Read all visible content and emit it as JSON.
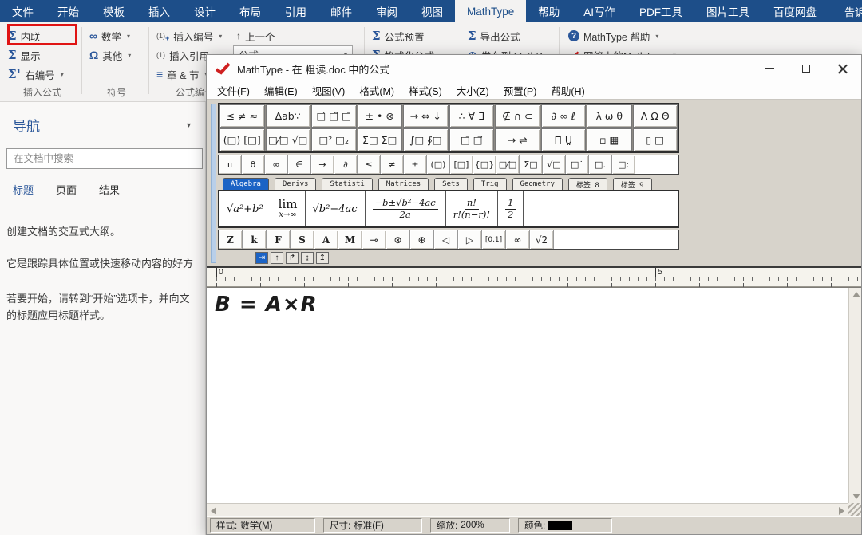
{
  "colors": {
    "ribbon_blue": "#1d4e89",
    "accent_blue": "#2b579a",
    "highlight_red": "#e01414",
    "tab_selected_blue": "#1b63c5",
    "status_swatch": "#000000"
  },
  "ribbon": {
    "tabs": [
      {
        "label": "文件"
      },
      {
        "label": "开始"
      },
      {
        "label": "模板"
      },
      {
        "label": "插入"
      },
      {
        "label": "设计"
      },
      {
        "label": "布局"
      },
      {
        "label": "引用"
      },
      {
        "label": "邮件"
      },
      {
        "label": "审阅"
      },
      {
        "label": "视图"
      },
      {
        "label": "MathType",
        "selected": true
      },
      {
        "label": "帮助"
      },
      {
        "label": "AI写作"
      },
      {
        "label": "PDF工具"
      },
      {
        "label": "图片工具"
      },
      {
        "label": "百度网盘"
      }
    ],
    "tell_me": "告诉我你",
    "buttons": {
      "inline": "内联",
      "display": "显示",
      "right_number": "右编号",
      "math": "数学",
      "other": "其他",
      "insert_number": "插入编号",
      "insert_reference": "插入引用",
      "chapter_section": "章 & 节",
      "previous": "上一个",
      "formula_box": "公式",
      "preset": "公式预置",
      "format": "格式化公式",
      "export": "导出公式",
      "publish": "发布到 MathPage",
      "help": "MathType 帮助",
      "web": "网络上的MathType"
    },
    "group_labels": {
      "insert": "插入公式",
      "symbols": "符号",
      "numbering": "公式编号"
    }
  },
  "icons": {
    "sigma": "Σ",
    "sigma_sup": "1",
    "infinity": "∞",
    "omega": "Ω",
    "up_arrow": "↑",
    "list": "≡",
    "number_badge": "(1)",
    "plus": "+",
    "globe": "⊕",
    "question": "?",
    "caret": "▾"
  },
  "sidebar": {
    "title": "导航",
    "search_placeholder": "在文档中搜索",
    "tabs": [
      {
        "label": "标题",
        "selected": true
      },
      {
        "label": "页面"
      },
      {
        "label": "结果"
      }
    ],
    "paragraphs": [
      "创建文档的交互式大纲。",
      "它是跟踪具体位置或快速移动内容的好方",
      "若要开始，请转到“开始”选项卡，并向文",
      "的标题应用标题样式。"
    ]
  },
  "mathtype": {
    "window_title": "MathType - 在 粗读.doc 中的公式",
    "menus": [
      "文件(F)",
      "编辑(E)",
      "视图(V)",
      "格式(M)",
      "样式(S)",
      "大小(Z)",
      "预置(P)",
      "帮助(H)"
    ],
    "palette_row1": [
      "≤ ≠ ≈",
      "∆ab∵",
      "□́ □̈ □̄",
      "± • ⊗",
      "→ ⇔ ↓",
      "∴ ∀ ∃",
      "∉ ∩ ⊂",
      "∂ ∞ ℓ",
      "λ ω θ",
      "Λ Ω Θ"
    ],
    "palette_row2": [
      "(□) [□]",
      "□⁄□ √□",
      "□² □₂",
      "Σ□ Σ□",
      "∫□ ∮□",
      "□̄ □⃗",
      "→ ⇌",
      "Π̈ Ṳ",
      "▫ ▦",
      "▯ □"
    ],
    "small_row": [
      "π",
      "θ",
      "∞",
      "∈",
      "→",
      "∂",
      "≤",
      "≠",
      "±",
      "(□)",
      "[□]",
      "{□}",
      "□⁄□",
      "Σ□",
      "√□",
      "□˙",
      "□.",
      "□:"
    ],
    "tabs": [
      {
        "label": "Algebra",
        "selected": true
      },
      {
        "label": "Derivs"
      },
      {
        "label": "Statisti"
      },
      {
        "label": "Matrices"
      },
      {
        "label": "Sets"
      },
      {
        "label": "Trig"
      },
      {
        "label": "Geometry"
      },
      {
        "label": "标签 8"
      },
      {
        "label": "标签 9"
      }
    ],
    "templates": [
      {
        "text": "√a²+b²"
      },
      {
        "top": "lim",
        "bottom": "x→∞"
      },
      {
        "text": "√b²−4ac"
      },
      {
        "top": "−b±√b²−4ac",
        "bottom": "2a"
      },
      {
        "top": "n!",
        "bottom": "r!(n−r)!"
      },
      {
        "top": "1",
        "bottom": "2"
      }
    ],
    "letters_row": [
      "Z",
      "k",
      "F",
      "S",
      "A",
      "M",
      "⊸",
      "⊗",
      "⊕",
      "◁",
      "▷",
      "[0,1]",
      "∞",
      "√2"
    ],
    "tabstops": [
      {
        "label": "⇥",
        "selected": true
      },
      {
        "label": "↑"
      },
      {
        "label": "↱"
      },
      {
        "label": "↨"
      },
      {
        "label": "↥"
      }
    ],
    "ruler_marks": [
      "0",
      "5"
    ],
    "equation": "B = A×R",
    "status": {
      "style_label": "样式:",
      "style_value": "数学(M)",
      "size_label": "尺寸:",
      "size_value": "标准(F)",
      "zoom_label": "缩放:",
      "zoom_value": "200%",
      "color_label": "颜色:"
    }
  }
}
